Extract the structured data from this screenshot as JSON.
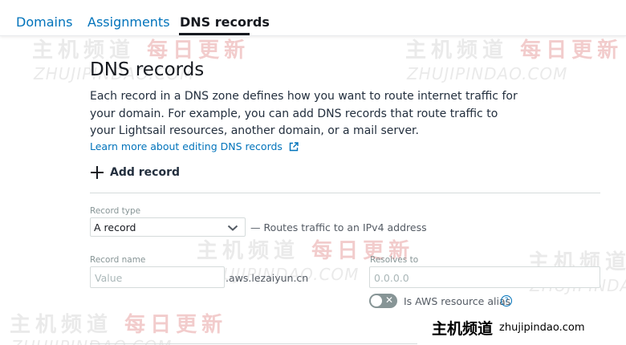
{
  "tabs": [
    {
      "label": "Domains"
    },
    {
      "label": "Assignments"
    },
    {
      "label": "DNS records"
    }
  ],
  "page": {
    "title": "DNS records",
    "description": "Each record in a DNS zone defines how you want to route internet traffic for your domain. For example, you can add DNS records that route traffic to your Lightsail resources, another domain, or a mail server.",
    "learn_more": "Learn more about editing DNS records",
    "add_record": "Add record"
  },
  "form": {
    "record_type_label": "Record type",
    "record_type_value": "A record",
    "record_type_note": "— Routes traffic to an IPv4 address",
    "record_name_label": "Record name",
    "record_name_placeholder": "Value",
    "domain_suffix": ".aws.lezaiyun.cn",
    "resolves_to_label": "Resolves to",
    "resolves_to_placeholder": "0.0.0.0",
    "alias_label": "Is AWS resource alias",
    "alias_toggle": "off"
  },
  "watermark": {
    "cn_grey": "主机频道",
    "cn_red": "每日更新",
    "en": "ZHUJIPINDAO.COM"
  },
  "brand": {
    "cn": "主机频道",
    "en": "zhujipindao.com"
  },
  "colors": {
    "link": "#0073bb",
    "text": "#232f3e",
    "border": "#d5dbdb"
  }
}
